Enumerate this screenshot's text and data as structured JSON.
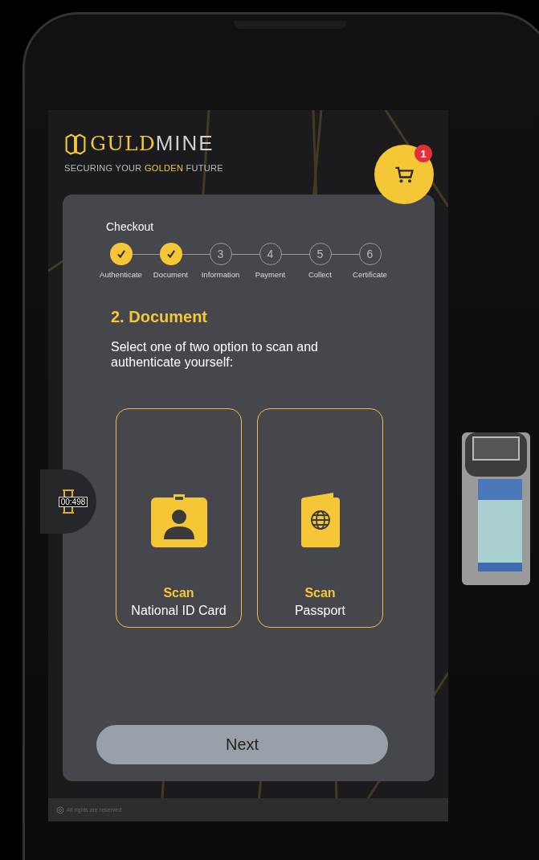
{
  "brand": {
    "name_first": "GULD",
    "name_second": "MINE",
    "tagline": "SECURING YOUR **GOLDEN** FUTURE"
  },
  "cart": {
    "badge": "1"
  },
  "timer": {
    "value": "00:498"
  },
  "checkout": {
    "title": "Checkout",
    "steps": [
      {
        "label": "Authenticate",
        "done": true
      },
      {
        "label": "Document",
        "done": true
      },
      {
        "label": "Information",
        "number": "3",
        "done": false
      },
      {
        "label": "Payment",
        "number": "4",
        "done": false
      },
      {
        "label": "Collect",
        "number": "5",
        "done": false
      },
      {
        "label": "Certificate",
        "number": "6",
        "done": false
      }
    ]
  },
  "section": {
    "heading": "2. Document",
    "instruction": "Select one of two option to scan and authenticate yourself:"
  },
  "options": [
    {
      "kind": "id-card",
      "action": "Scan",
      "label": "National ID Card"
    },
    {
      "kind": "passport",
      "action": "Scan",
      "label": "Passport"
    }
  ],
  "next_button": "Next",
  "footer": "All rights are reserved"
}
